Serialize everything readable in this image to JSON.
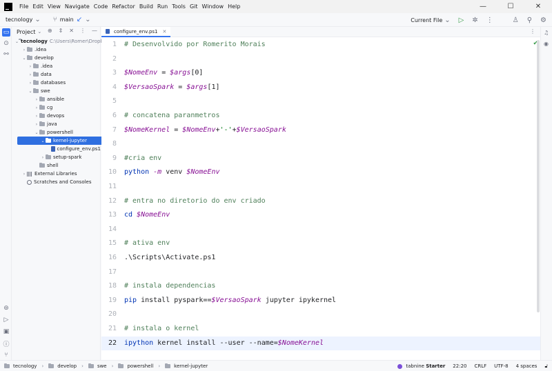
{
  "menu": [
    "File",
    "Edit",
    "View",
    "Navigate",
    "Code",
    "Refactor",
    "Build",
    "Run",
    "Tools",
    "Git",
    "Window",
    "Help"
  ],
  "window_controls": {
    "minimize": "—",
    "maximize": "☐",
    "close": "✕"
  },
  "toolbar": {
    "project_name": "tecnology",
    "branch": "main",
    "run_config": "Current File"
  },
  "project_panel": {
    "title": "Project",
    "root_name": "tecnology",
    "root_path": "C:\\Users\\Romer\\Dropb",
    "items": [
      {
        "label": ".idea",
        "depth": 1,
        "type": "folder",
        "expanded": false
      },
      {
        "label": "develop",
        "depth": 1,
        "type": "folder",
        "expanded": true
      },
      {
        "label": ".idea",
        "depth": 2,
        "type": "folder",
        "expanded": false
      },
      {
        "label": "data",
        "depth": 2,
        "type": "folder",
        "expanded": false
      },
      {
        "label": "databases",
        "depth": 2,
        "type": "folder",
        "expanded": false
      },
      {
        "label": "swe",
        "depth": 2,
        "type": "folder",
        "expanded": true
      },
      {
        "label": "ansible",
        "depth": 3,
        "type": "folder",
        "expanded": false
      },
      {
        "label": "cg",
        "depth": 3,
        "type": "folder",
        "expanded": false
      },
      {
        "label": "devops",
        "depth": 3,
        "type": "folder",
        "expanded": false
      },
      {
        "label": "java",
        "depth": 3,
        "type": "folder",
        "expanded": false
      },
      {
        "label": "powershell",
        "depth": 3,
        "type": "folder",
        "expanded": true
      },
      {
        "label": "kernel-jupyter",
        "depth": 4,
        "type": "folder",
        "expanded": true,
        "selected": true
      },
      {
        "label": "configure_env.ps1",
        "depth": 5,
        "type": "ps1"
      },
      {
        "label": "setup-spark",
        "depth": 4,
        "type": "folder",
        "expanded": false
      },
      {
        "label": "shell",
        "depth": 3,
        "type": "folder",
        "leaf": true
      },
      {
        "label": "External Libraries",
        "depth": 1,
        "type": "lib",
        "expanded": false
      },
      {
        "label": "Scratches and Consoles",
        "depth": 1,
        "type": "scratch",
        "leaf": true
      }
    ]
  },
  "editor": {
    "tab_label": "configure_env.ps1",
    "current_line": 22,
    "lines": [
      {
        "n": "1",
        "tokens": [
          [
            "c-comment",
            "# Desenvolvido por Romerito Morais"
          ]
        ]
      },
      {
        "n": "2",
        "tokens": []
      },
      {
        "n": "3",
        "tokens": [
          [
            "c-var",
            "$NomeEnv"
          ],
          [
            "c-op",
            " = "
          ],
          [
            "c-var",
            "$args"
          ],
          [
            "c-op",
            "[0]"
          ]
        ]
      },
      {
        "n": "4",
        "tokens": [
          [
            "c-var",
            "$VersaoSpark"
          ],
          [
            "c-op",
            " = "
          ],
          [
            "c-var",
            "$args"
          ],
          [
            "c-op",
            "[1]"
          ]
        ]
      },
      {
        "n": "5",
        "tokens": []
      },
      {
        "n": "6",
        "tokens": [
          [
            "c-comment",
            "# concatena paranmetros"
          ]
        ]
      },
      {
        "n": "7",
        "tokens": [
          [
            "c-var",
            "$NomeKernel"
          ],
          [
            "c-op",
            " = "
          ],
          [
            "c-var",
            "$NomeEnv"
          ],
          [
            "c-op",
            "+"
          ],
          [
            "c-str",
            "'-'"
          ],
          [
            "c-op",
            "+"
          ],
          [
            "c-var",
            "$VersaoSpark"
          ]
        ]
      },
      {
        "n": "8",
        "tokens": []
      },
      {
        "n": "9",
        "tokens": [
          [
            "c-comment",
            "#cria env"
          ]
        ]
      },
      {
        "n": "10",
        "tokens": [
          [
            "c-kw",
            "python"
          ],
          [
            "c-op",
            " "
          ],
          [
            "c-var",
            "-m"
          ],
          [
            "c-op",
            " venv "
          ],
          [
            "c-var",
            "$NomeEnv"
          ]
        ]
      },
      {
        "n": "11",
        "tokens": []
      },
      {
        "n": "12",
        "tokens": [
          [
            "c-comment",
            "# entra no diretorio do env criado"
          ]
        ]
      },
      {
        "n": "13",
        "tokens": [
          [
            "c-kw",
            "cd"
          ],
          [
            "c-op",
            " "
          ],
          [
            "c-var",
            "$NomeEnv"
          ]
        ]
      },
      {
        "n": "14",
        "tokens": []
      },
      {
        "n": "15",
        "tokens": [
          [
            "c-comment",
            "# ativa env"
          ]
        ]
      },
      {
        "n": "16",
        "tokens": [
          [
            "c-op",
            ".\\Scripts\\Activate.ps1"
          ]
        ]
      },
      {
        "n": "17",
        "tokens": []
      },
      {
        "n": "18",
        "tokens": [
          [
            "c-comment",
            "# instala dependencias"
          ]
        ]
      },
      {
        "n": "19",
        "tokens": [
          [
            "c-kw",
            "pip"
          ],
          [
            "c-op",
            " install pyspark=="
          ],
          [
            "c-var",
            "$VersaoSpark"
          ],
          [
            "c-op",
            " jupyter ipykernel"
          ]
        ]
      },
      {
        "n": "20",
        "tokens": []
      },
      {
        "n": "21",
        "tokens": [
          [
            "c-comment",
            "# instala o kernel"
          ]
        ]
      },
      {
        "n": "22",
        "tokens": [
          [
            "c-kw",
            "ipython"
          ],
          [
            "c-op",
            " kernel install --user --name="
          ],
          [
            "c-var",
            "$NomeKernel"
          ]
        ]
      }
    ]
  },
  "statusbar": {
    "breadcrumbs": [
      "tecnology",
      "develop",
      "swe",
      "powershell",
      "kernel-jupyter"
    ],
    "tabnine_prefix": "tabnine",
    "tabnine_plan": "Starter",
    "cursor": "22:20",
    "line_sep": "CRLF",
    "encoding": "UTF-8",
    "indent": "4 spaces"
  },
  "colors": {
    "accent": "#3574f0",
    "selection": "#2f6fe0",
    "current_line": "#edf3ff",
    "comment": "#4e7f59",
    "variable": "#871094",
    "keyword": "#0033b3",
    "string": "#067d17"
  }
}
